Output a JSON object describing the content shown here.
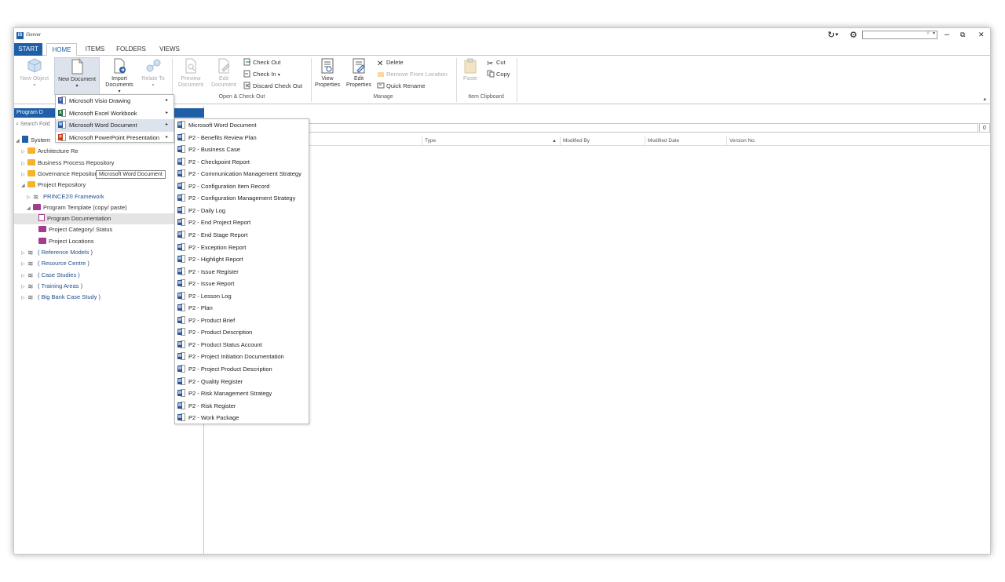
{
  "app": {
    "title": "iServer",
    "logo": "iS"
  },
  "titlebar": {
    "refresh_icon": "refresh-icon",
    "settings_icon": "gear-icon",
    "search_placeholder": "",
    "minimize": "–",
    "restore": "⧉",
    "close": "✕"
  },
  "tabs": {
    "start": "START",
    "home": "HOME",
    "items": "ITEMS",
    "folders": "FOLDERS",
    "views": "VIEWS"
  },
  "ribbon": {
    "new_object": "New Object",
    "new_document": "New Document",
    "import_documents_1": "Import",
    "import_documents_2": "Documents",
    "relate_to": "Relate To",
    "preview_document_1": "Preview",
    "preview_document_2": "Document",
    "edit_document_1": "Edit",
    "edit_document_2": "Document",
    "check_out": "Check Out",
    "check_in": "Check In",
    "discard_check_out": "Discard Check Out",
    "group_open_checkout": "Open & Check Out",
    "view_properties_1": "View",
    "view_properties_2": "Properties",
    "edit_properties_1": "Edit",
    "edit_properties_2": "Properties",
    "delete": "Delete",
    "remove_from_location": "Remove From Location",
    "quick_rename": "Quick Rename",
    "group_manage": "Manage",
    "paste": "Paste",
    "cut": "Cut",
    "copy": "Copy",
    "group_clipboard": "Item Clipboard"
  },
  "left_panel": {
    "header": "Program D",
    "search_placeholder": "Search Fold",
    "tree": [
      {
        "label": "System",
        "level": 0,
        "icon": "system-icon",
        "expanded": true
      },
      {
        "label": "Architecture Re",
        "level": 1,
        "icon": "folder-icon"
      },
      {
        "label": "Business Process Repository",
        "level": 1,
        "icon": "folder-icon"
      },
      {
        "label": "Governance Repository",
        "level": 1,
        "icon": "folder-icon"
      },
      {
        "label": "Project Repository",
        "level": 1,
        "icon": "folder-icon",
        "expanded": true
      },
      {
        "label": "PRINCE2® Framework",
        "level": 2,
        "icon": "stack-icon",
        "link": true
      },
      {
        "label": "Program Template (copy/ paste)",
        "level": 2,
        "icon": "purple-folder-icon",
        "expanded": true
      },
      {
        "label": "Program Documentation",
        "level": 3,
        "icon": "document-icon",
        "selected": true
      },
      {
        "label": "Project Category/ Status",
        "level": 3,
        "icon": "purple-folder-icon"
      },
      {
        "label": "Project Locations",
        "level": 3,
        "icon": "purple-folder-icon"
      },
      {
        "label": "( Reference Models )",
        "level": 1,
        "icon": "stack-icon",
        "link": true
      },
      {
        "label": "( Resource Centre )",
        "level": 1,
        "icon": "stack-icon",
        "link": true
      },
      {
        "label": "( Case Studies )",
        "level": 1,
        "icon": "stack-icon",
        "link": true
      },
      {
        "label": "( Training Areas )",
        "level": 1,
        "icon": "stack-icon",
        "link": true
      },
      {
        "label": "( Big Bank Case Study )",
        "level": 1,
        "icon": "stack-icon",
        "link": true
      }
    ]
  },
  "main": {
    "count": "0",
    "columns": [
      "Type",
      "Modified By",
      "Modified Date",
      "Version No."
    ]
  },
  "new_doc_menu": [
    {
      "label": "Microsoft Visio Drawing",
      "app": "V",
      "color": "#3955a3"
    },
    {
      "label": "Microsoft Excel Workbook",
      "app": "X",
      "color": "#1e7145"
    },
    {
      "label": "Microsoft Word Document",
      "app": "W",
      "color": "#2b579a"
    },
    {
      "label": "Microsoft PowerPoint Presentation",
      "app": "P",
      "color": "#c43e1c"
    }
  ],
  "tooltip": "Microsoft Word Document",
  "word_submenu": [
    "Microsoft Word Document",
    "P2 - Benefits Review Plan",
    "P2 - Business Case",
    "P2 - Checkpoint Report",
    "P2 - Communication Management Strategy",
    "P2 - Configuration Item Record",
    "P2 - Configuration Management Strategy",
    "P2 - Daily Log",
    "P2 - End Project Report",
    "P2 - End Stage Report",
    "P2 - Exception Report",
    "P2 - Highlight Report",
    "P2 - Issue Register",
    "P2 - Issue Report",
    "P2 - Lesson Log",
    "P2 - Plan",
    "P2 - Product Brief",
    "P2 - Product Description",
    "P2 - Product Status Account",
    "P2 - Project Initiation Documentation",
    "P2 - Project Product Description",
    "P2 - Quality Register",
    "P2 - Risk Management Strategy",
    "P2 - Risk Register",
    "P2 - Work Package"
  ],
  "colors": {
    "accent": "#1f5fa8",
    "folder": "#f5b32b",
    "program_folder": "#a43c8d",
    "menu_hover": "#dce3ec"
  }
}
